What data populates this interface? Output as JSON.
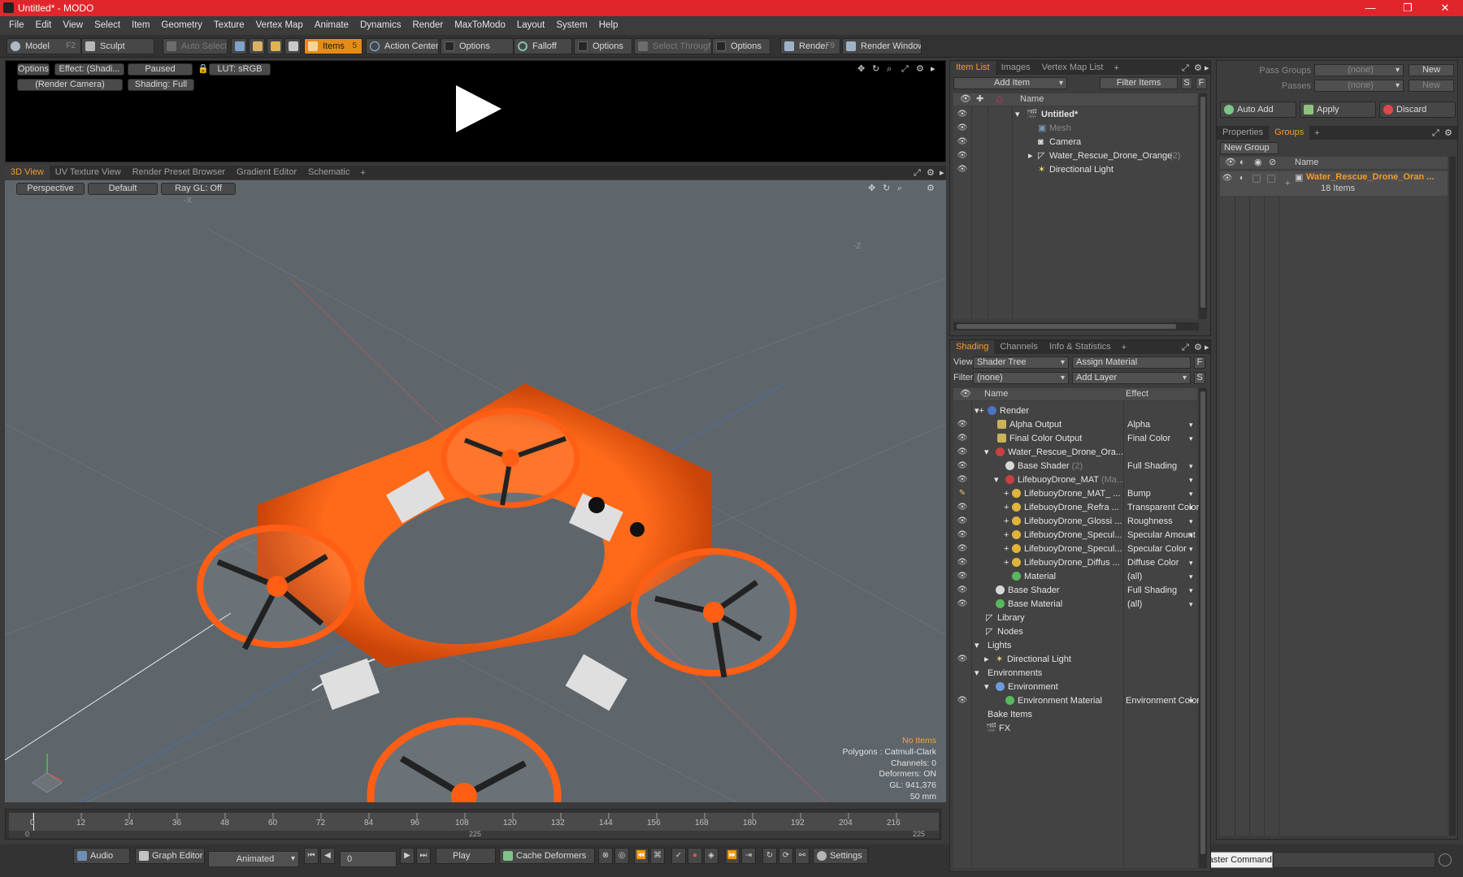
{
  "window": {
    "title": "Untitled* - MODO",
    "min": "—",
    "max": "❐",
    "close": "✕"
  },
  "menu": [
    "File",
    "Edit",
    "View",
    "Select",
    "Item",
    "Geometry",
    "Texture",
    "Vertex Map",
    "Animate",
    "Dynamics",
    "Render",
    "MaxToModo",
    "Layout",
    "System",
    "Help"
  ],
  "toolbar": {
    "model": "Model",
    "model_key": "F2",
    "sculpt": "Sculpt",
    "auto_select": "Auto Select",
    "items": "Items",
    "items_key": "5",
    "action_center": "Action Center",
    "options1": "Options",
    "falloff": "Falloff",
    "options2": "Options",
    "select_through": "Select Through",
    "options3": "Options",
    "render": "Render",
    "render_key": "F9",
    "render_window": "Render Window"
  },
  "preview": {
    "options": "Options",
    "effect": "Effect: (Shadi...",
    "paused": "Paused",
    "lut": "LUT: sRGB",
    "camera": "(Render Camera)",
    "shading": "Shading: Full"
  },
  "viewport": {
    "tabs": [
      "3D View",
      "UV Texture View",
      "Render Preset Browser",
      "Gradient Editor",
      "Schematic"
    ],
    "perspective": "Perspective",
    "default": "Default",
    "raygl": "Ray GL: Off",
    "axis_x": "-X",
    "axis_z": "-Z",
    "info": {
      "no_items": "No Items",
      "polygons": "Polygons : Catmull-Clark",
      "channels": "Channels: 0",
      "deformers": "Deformers: ON",
      "gl": "GL: 941,376",
      "mm": "50 mm"
    }
  },
  "item_list": {
    "tabs": [
      "Item List",
      "Images",
      "Vertex Map List"
    ],
    "add_item": "Add Item",
    "filter": "Filter Items",
    "s": "S",
    "f": "F",
    "col_name": "Name",
    "rows": [
      {
        "name": "Untitled*",
        "bold": true
      },
      {
        "name": "Mesh",
        "dim": true
      },
      {
        "name": "Camera"
      },
      {
        "name": "Water_Rescue_Drone_Orange",
        "count": "(2)"
      },
      {
        "name": "Directional Light"
      }
    ]
  },
  "shading": {
    "tabs": [
      "Shading",
      "Channels",
      "Info & Statistics"
    ],
    "view_label": "View",
    "view_val": "Shader Tree",
    "assign": "Assign Material",
    "f": "F",
    "filter_label": "Filter",
    "filter_val": "(none)",
    "add_layer": "Add Layer",
    "s": "S",
    "col_name": "Name",
    "col_effect": "Effect",
    "rows": [
      {
        "name": "Render",
        "effect": ""
      },
      {
        "name": "Alpha Output",
        "effect": "Alpha"
      },
      {
        "name": "Final Color Output",
        "effect": "Final Color"
      },
      {
        "name": "Water_Rescue_Drone_Ora...",
        "effect": ""
      },
      {
        "name": "Base Shader",
        "count": "(2)",
        "effect": "Full Shading"
      },
      {
        "name": "LifebuoyDrone_MAT",
        "count": "(Ma...",
        "effect": ""
      },
      {
        "name": "LifebuoyDrone_MAT_ ...",
        "effect": "Bump"
      },
      {
        "name": "LifebuoyDrone_Refra ...",
        "effect": "Transparent Color"
      },
      {
        "name": "LifebuoyDrone_Glossi ...",
        "effect": "Roughness"
      },
      {
        "name": "LifebuoyDrone_Specul...",
        "effect": "Specular Amount"
      },
      {
        "name": "LifebuoyDrone_Specul...",
        "effect": "Specular Color"
      },
      {
        "name": "LifebuoyDrone_Diffus ...",
        "effect": "Diffuse Color"
      },
      {
        "name": "Material",
        "effect": "(all)"
      },
      {
        "name": "Base Shader",
        "effect": "Full Shading"
      },
      {
        "name": "Base Material",
        "effect": "(all)"
      },
      {
        "name": "Library",
        "effect": ""
      },
      {
        "name": "Nodes",
        "effect": ""
      },
      {
        "name": "Lights",
        "effect": ""
      },
      {
        "name": "Directional Light",
        "effect": ""
      },
      {
        "name": "Environments",
        "effect": ""
      },
      {
        "name": "Environment",
        "effect": ""
      },
      {
        "name": "Environment Material",
        "effect": "Environment Color"
      },
      {
        "name": "Bake Items",
        "effect": ""
      },
      {
        "name": "FX",
        "effect": ""
      }
    ]
  },
  "groups": {
    "pass_groups": "Pass Groups",
    "passes": "Passes",
    "none1": "(none)",
    "none2": "(none)",
    "new1": "New",
    "new2": "New",
    "auto_add": "Auto Add",
    "apply": "Apply",
    "discard": "Discard",
    "tabs": [
      "Properties",
      "Groups"
    ],
    "new_group": "New Group",
    "col_name": "Name",
    "group_name": "Water_Rescue_Drone_Oran ...",
    "group_count": "18 Items"
  },
  "timeline": {
    "ticks": [
      "0",
      "12",
      "24",
      "36",
      "48",
      "60",
      "72",
      "84",
      "96",
      "108",
      "120",
      "132",
      "144",
      "156",
      "168",
      "180",
      "192",
      "204",
      "216"
    ],
    "start": "0",
    "mid": "225",
    "end": "225"
  },
  "bottom": {
    "audio": "Audio",
    "graph_editor": "Graph Editor",
    "animated": "Animated",
    "frame": "0",
    "play": "Play",
    "cache": "Cache Deformers",
    "settings": "Settings",
    "tooltip": "Sound Blaster Command"
  }
}
